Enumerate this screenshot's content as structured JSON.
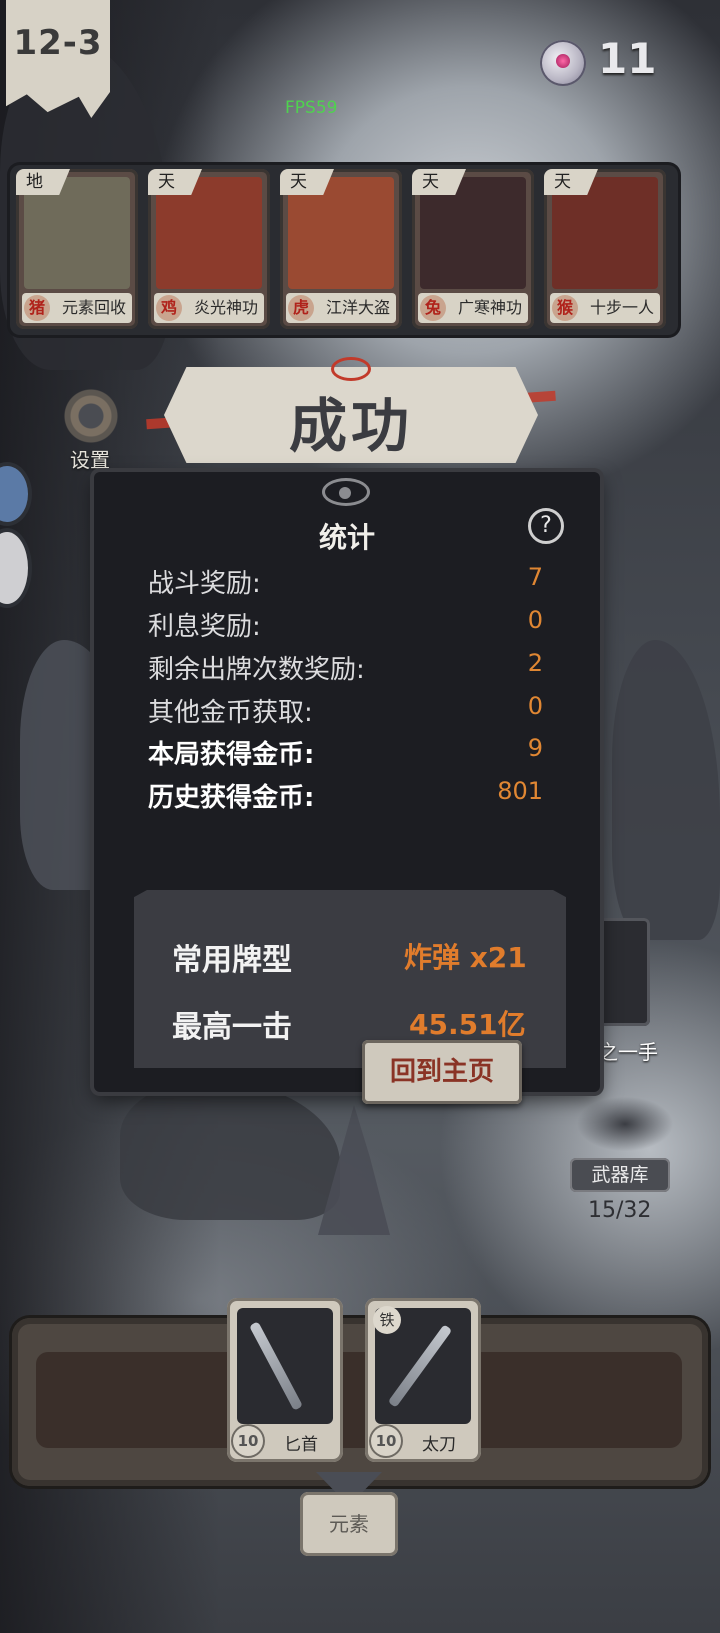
{
  "hud": {
    "level": "12-3",
    "gem_count": "11",
    "fps": "FPS59"
  },
  "cards": [
    {
      "tier": "地",
      "zodiac": "猪",
      "name": "元素回收",
      "art_color": "#6f6b5a"
    },
    {
      "tier": "天",
      "zodiac": "鸡",
      "name": "炎光神功",
      "art_color": "#8c3b2c"
    },
    {
      "tier": "天",
      "zodiac": "虎",
      "name": "江洋大盗",
      "art_color": "#9a4a32"
    },
    {
      "tier": "天",
      "zodiac": "兔",
      "name": "广寒神功",
      "art_color": "#3d2a2c"
    },
    {
      "tier": "天",
      "zodiac": "猴",
      "name": "十步一人",
      "art_color": "#6e2f27"
    }
  ],
  "banner": {
    "title": "成功"
  },
  "settings": {
    "label": "设置"
  },
  "stats": {
    "title": "统计",
    "rows": [
      {
        "label": "战斗奖励:",
        "value": "7"
      },
      {
        "label": "利息奖励:",
        "value": "0"
      },
      {
        "label": "剩余出牌次数奖励:",
        "value": "2"
      },
      {
        "label": "其他金币获取:",
        "value": "0"
      },
      {
        "label": "本局获得金币:",
        "value": "9"
      },
      {
        "label": "历史获得金币:",
        "value": "801"
      }
    ],
    "summary": {
      "common_hand_label": "常用牌型",
      "common_hand_value": "炸弹 x21",
      "top_hit_label": "最高一击",
      "top_hit_value": "45.51亿"
    },
    "home_button": "回到主页"
  },
  "side": {
    "deck_label": "神之一手",
    "armory_label": "武器库",
    "armory_count": "15/32"
  },
  "hand": [
    {
      "name": "匕首",
      "cost": "10",
      "tag": ""
    },
    {
      "name": "太刀",
      "cost": "10",
      "tag": "铁"
    }
  ],
  "element_button": "元素",
  "colors": {
    "accent": "#e08733",
    "banner_red": "#c23a2a",
    "fps_green": "#4fd24f"
  }
}
